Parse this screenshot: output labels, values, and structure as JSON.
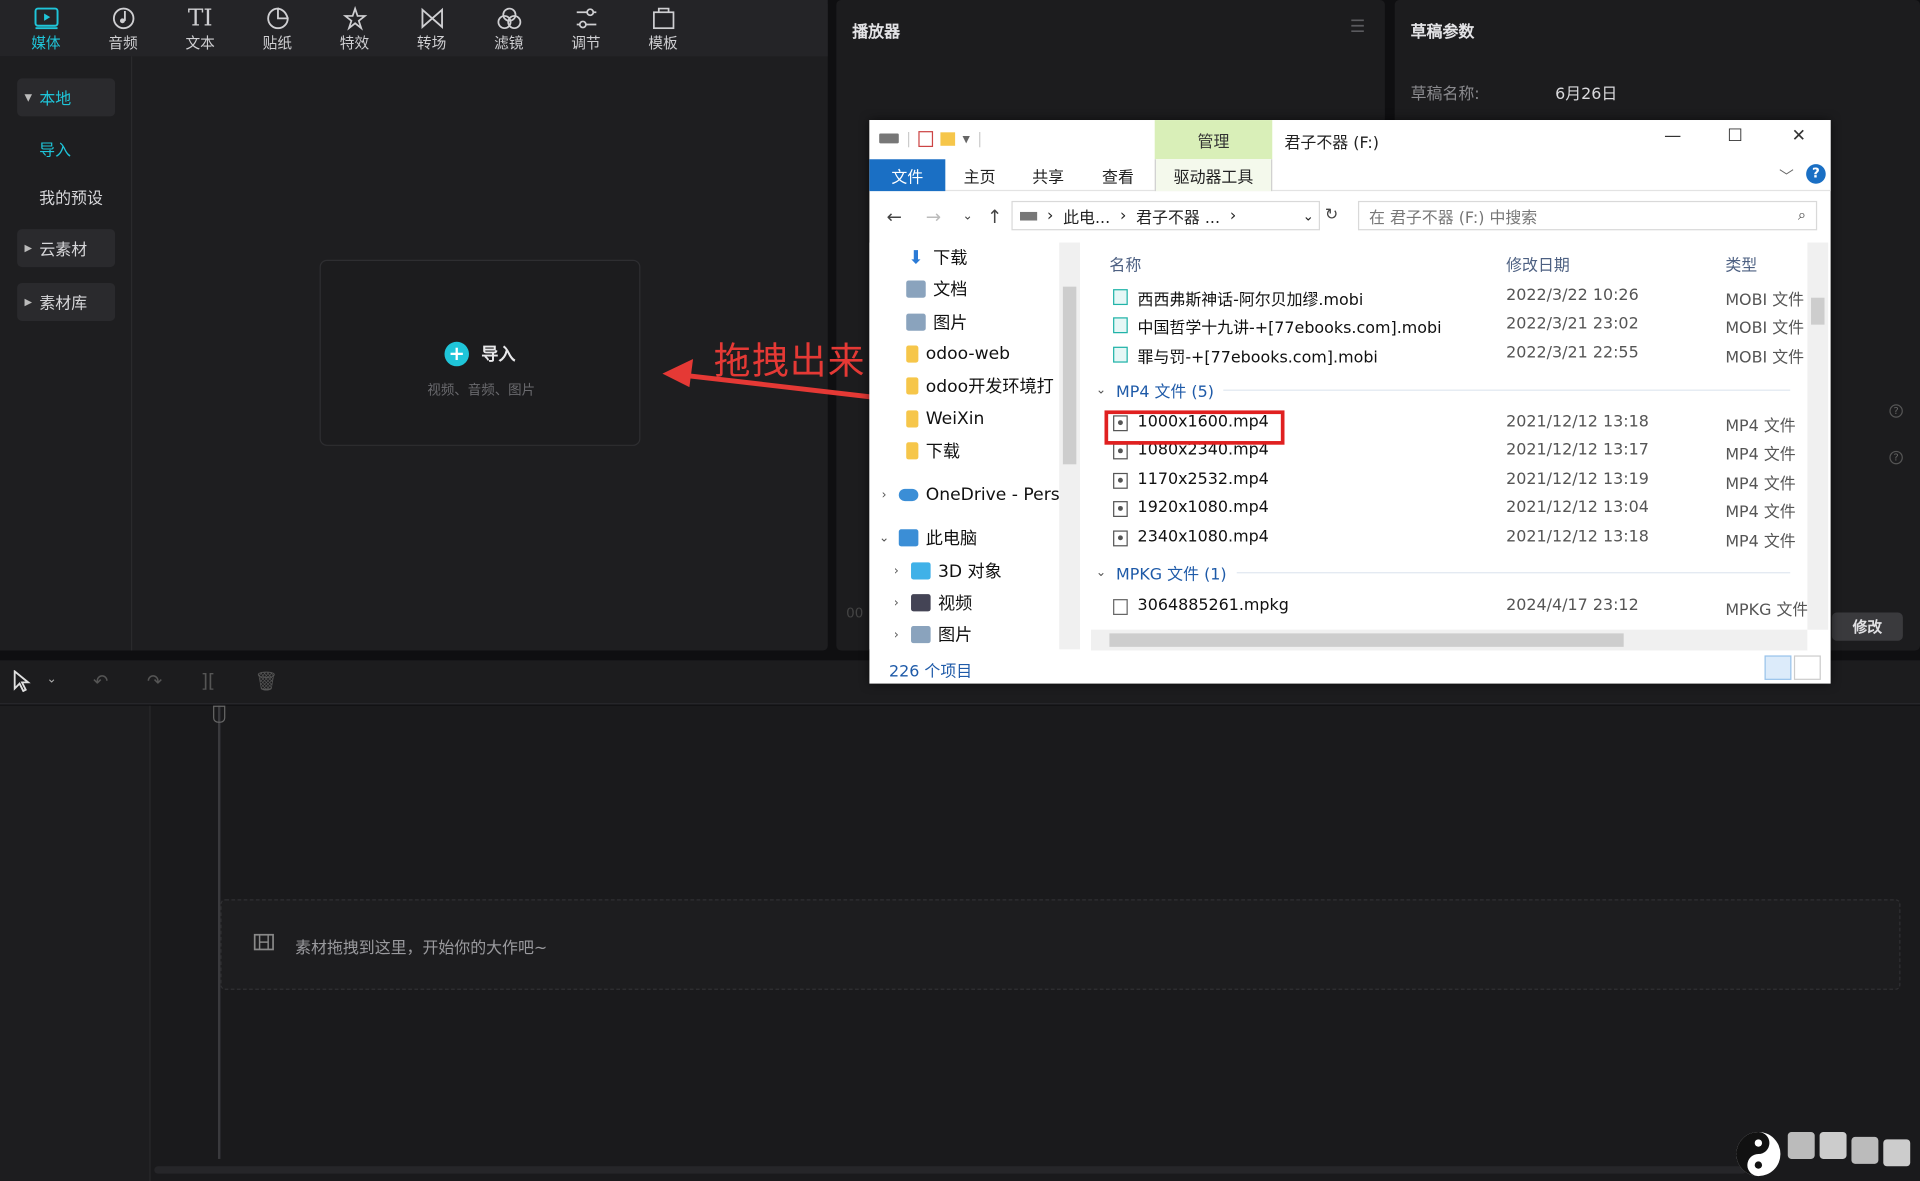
{
  "toolbar": {
    "tabs": [
      {
        "label": "媒体",
        "icon": "media-icon"
      },
      {
        "label": "音频",
        "icon": "audio-icon"
      },
      {
        "label": "文本",
        "icon": "text-icon"
      },
      {
        "label": "贴纸",
        "icon": "sticker-icon"
      },
      {
        "label": "特效",
        "icon": "effects-icon"
      },
      {
        "label": "转场",
        "icon": "transition-icon"
      },
      {
        "label": "滤镜",
        "icon": "filter-icon"
      },
      {
        "label": "调节",
        "icon": "adjust-icon"
      },
      {
        "label": "模板",
        "icon": "template-icon"
      }
    ],
    "text_glyph": "TI"
  },
  "sidebar": {
    "local": "本地",
    "import": "导入",
    "presets": "我的预设",
    "cloud": "云素材",
    "library": "素材库"
  },
  "import_box": {
    "label": "导入",
    "sub": "视频、音频、图片"
  },
  "player": {
    "title": "播放器",
    "time": "00"
  },
  "params": {
    "title": "草稿参数",
    "name_label": "草稿名称:",
    "name_value": "6月26日",
    "edit": "修改"
  },
  "timeline": {
    "drop_text": "素材拖拽到这里，开始你的大作吧~"
  },
  "annotation": {
    "text": "拖拽出来"
  },
  "explorer": {
    "manage": "管理",
    "title": "君子不器 (F:)",
    "ribbon": {
      "file": "文件",
      "home": "主页",
      "share": "共享",
      "view": "查看",
      "drive_tools": "驱动器工具"
    },
    "address": [
      "此电...",
      "君子不器 ..."
    ],
    "search_placeholder": "在 君子不器 (F:) 中搜索",
    "nav": [
      {
        "label": "下载",
        "icon": "download-icon",
        "pinned": true
      },
      {
        "label": "文档",
        "icon": "document-icon",
        "pinned": true
      },
      {
        "label": "图片",
        "icon": "pictures-icon",
        "pinned": true
      },
      {
        "label": "odoo-web",
        "icon": "folder-icon"
      },
      {
        "label": "odoo开发环境打",
        "icon": "folder-icon"
      },
      {
        "label": "WeiXin",
        "icon": "folder-icon"
      },
      {
        "label": "下载",
        "icon": "folder-icon"
      },
      {
        "label": "OneDrive - Pers",
        "icon": "onedrive-icon"
      },
      {
        "label": "此电脑",
        "icon": "pc-icon"
      },
      {
        "label": "3D 对象",
        "icon": "3d-icon"
      },
      {
        "label": "视频",
        "icon": "video-icon"
      },
      {
        "label": "图片",
        "icon": "pictures-icon"
      }
    ],
    "columns": {
      "name": "名称",
      "date": "修改日期",
      "type": "类型"
    },
    "mobi_files": [
      {
        "name": "西西弗斯神话-阿尔贝加缪.mobi",
        "date": "2022/3/22 10:26",
        "type": "MOBI 文件"
      },
      {
        "name": "中国哲学十九讲-+[77ebooks.com].mobi",
        "date": "2022/3/21 23:02",
        "type": "MOBI 文件"
      },
      {
        "name": "罪与罚-+[77ebooks.com].mobi",
        "date": "2022/3/21 22:55",
        "type": "MOBI 文件"
      }
    ],
    "mp4_group": "MP4 文件 (5)",
    "mp4_files": [
      {
        "name": "1000x1600.mp4",
        "date": "2021/12/12 13:18",
        "type": "MP4 文件"
      },
      {
        "name": "1080x2340.mp4",
        "date": "2021/12/12 13:17",
        "type": "MP4 文件"
      },
      {
        "name": "1170x2532.mp4",
        "date": "2021/12/12 13:19",
        "type": "MP4 文件"
      },
      {
        "name": "1920x1080.mp4",
        "date": "2021/12/12 13:04",
        "type": "MP4 文件"
      },
      {
        "name": "2340x1080.mp4",
        "date": "2021/12/12 13:18",
        "type": "MP4 文件"
      }
    ],
    "mpkg_group": "MPKG 文件 (1)",
    "mpkg_files": [
      {
        "name": "3064885261.mpkg",
        "date": "2024/4/17 23:12",
        "type": "MPKG 文件"
      }
    ],
    "status": "226 个项目"
  },
  "colors": {
    "accent": "#1fc5d9",
    "annotation": "#e53935",
    "explorer_blue": "#1a6fc4"
  }
}
